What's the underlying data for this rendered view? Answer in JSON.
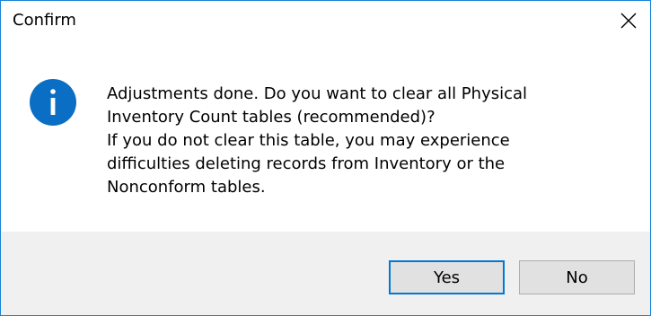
{
  "window": {
    "title": "Confirm",
    "close_icon": "close-icon",
    "accent_color": "#0078d7"
  },
  "message": {
    "icon": "info-icon",
    "icon_color": "#0a6fc4",
    "lines": [
      "Adjustments done. Do you want to clear all Physical",
      "Inventory Count tables (recommended)?",
      "If you do not clear this table, you may experience",
      "difficulties deleting records from Inventory or the",
      "Nonconform tables."
    ]
  },
  "buttons": {
    "yes_label": "Yes",
    "no_label": "No"
  }
}
